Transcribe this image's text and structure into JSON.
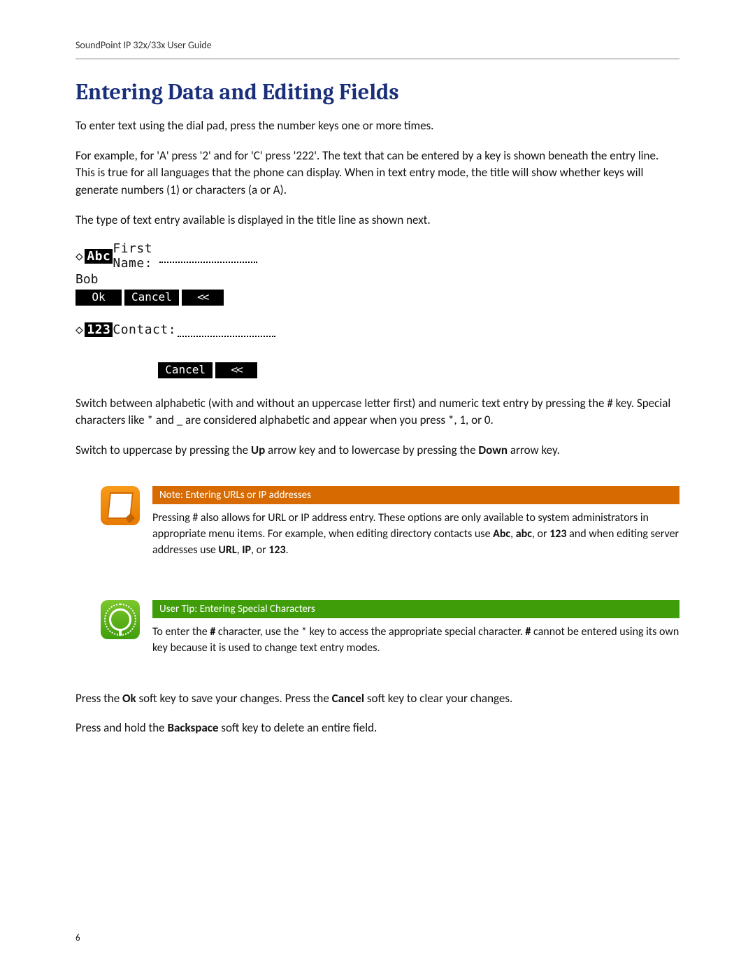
{
  "header": "SoundPoint IP 32x/33x User Guide",
  "heading": "Entering Data and Editing Fields",
  "p1": "To enter text using the dial pad, press the number keys one or more times.",
  "p2": "For example, for 'A' press '2' and for 'C' press '222'. The text that can be entered by a key is shown beneath the entry line. This is true for all languages that the phone can display. When in text entry mode, the title will show whether keys will generate numbers (1) or characters (a or A).",
  "p3": "The type of text entry available is displayed in the title line as shown next.",
  "lcd1": {
    "mode": "Abc",
    "label": "First Name:",
    "value": "Bob",
    "sk": {
      "ok": "Ok",
      "cancel": "Cancel",
      "back": "<<"
    }
  },
  "lcd2": {
    "mode": "123",
    "label": "Contact:",
    "sk": {
      "cancel": "Cancel",
      "back": "<<"
    }
  },
  "p4": "Switch between alphabetic (with and without an uppercase letter first) and numeric text entry by pressing the # key. Special characters like * and _ are considered alphabetic and appear when you press *, 1, or 0.",
  "p5_pre": "Switch to uppercase by pressing the ",
  "p5_up": "Up",
  "p5_mid": " arrow key and to lowercase by pressing the ",
  "p5_down": "Down",
  "p5_end": " arrow key.",
  "note": {
    "title": "Note: Entering URLs or IP addresses",
    "t1": "Pressing # also allows for URL or IP address entry. These options are only available to system administrators in appropriate menu items. For example, when editing directory contacts use ",
    "b1": "Abc",
    "t2": ", ",
    "b2": "abc",
    "t3": ", or ",
    "b3": "123",
    "t4": " and when editing server addresses use ",
    "b4": "URL",
    "t5": ", ",
    "b5": "IP",
    "t6": ", or ",
    "b6": "123",
    "t7": "."
  },
  "tip": {
    "title": "User Tip: Entering Special Characters",
    "t1": "To enter the ",
    "b1": "#",
    "t2": " character, use the * key to access the appropriate special character. ",
    "b2": "#",
    "t3": " cannot be entered using its own key because it is used to change text entry modes."
  },
  "p6_pre": "Press the ",
  "p6_ok": "Ok",
  "p6_mid": " soft key to save your changes. Press the ",
  "p6_cancel": "Cancel",
  "p6_end": " soft key to clear your changes.",
  "p7_pre": "Press and hold the ",
  "p7_bk": "Backspace",
  "p7_end": " soft key to delete an entire field.",
  "pageNumber": "6"
}
